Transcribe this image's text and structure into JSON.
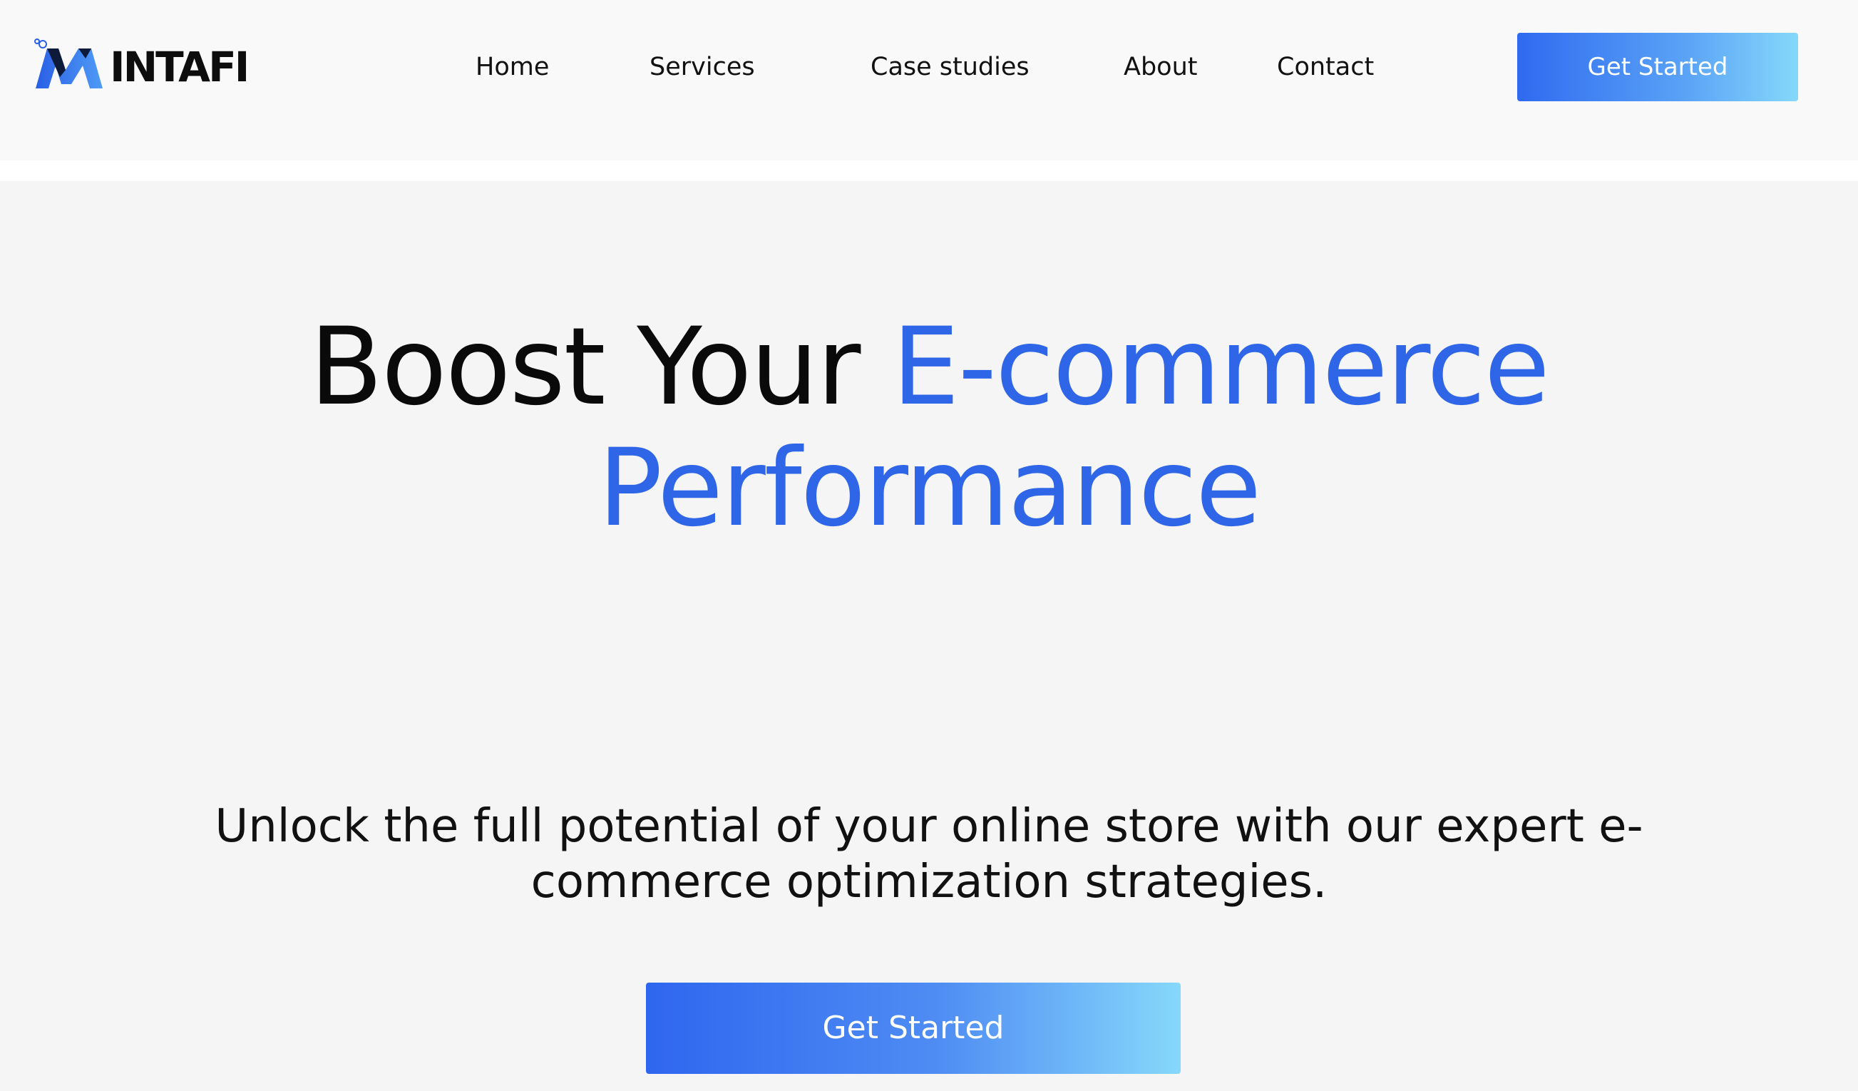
{
  "brand": {
    "logo_text": "INTAFI",
    "logo_icon": "m-letter-logo-icon",
    "colors": {
      "primary_blue": "#2f66e8",
      "gradient_start": "#2f6af0",
      "gradient_end": "#86d8fb",
      "text_dark": "#0a0a0a",
      "header_bg": "#f9f9f9",
      "hero_bg": "#f5f5f5"
    }
  },
  "nav": {
    "items": [
      {
        "label": "Home"
      },
      {
        "label": "Services"
      },
      {
        "label": "Case studies"
      },
      {
        "label": "About"
      },
      {
        "label": "Contact"
      }
    ],
    "cta_label": "Get Started"
  },
  "hero": {
    "title_plain": "Boost Your",
    "title_accent": "E-commerce Performance",
    "subtitle_line1": "Unlock the full potential of your online store with our expert e-",
    "subtitle_line2": "commerce optimization strategies.",
    "cta_label": "Get Started"
  }
}
